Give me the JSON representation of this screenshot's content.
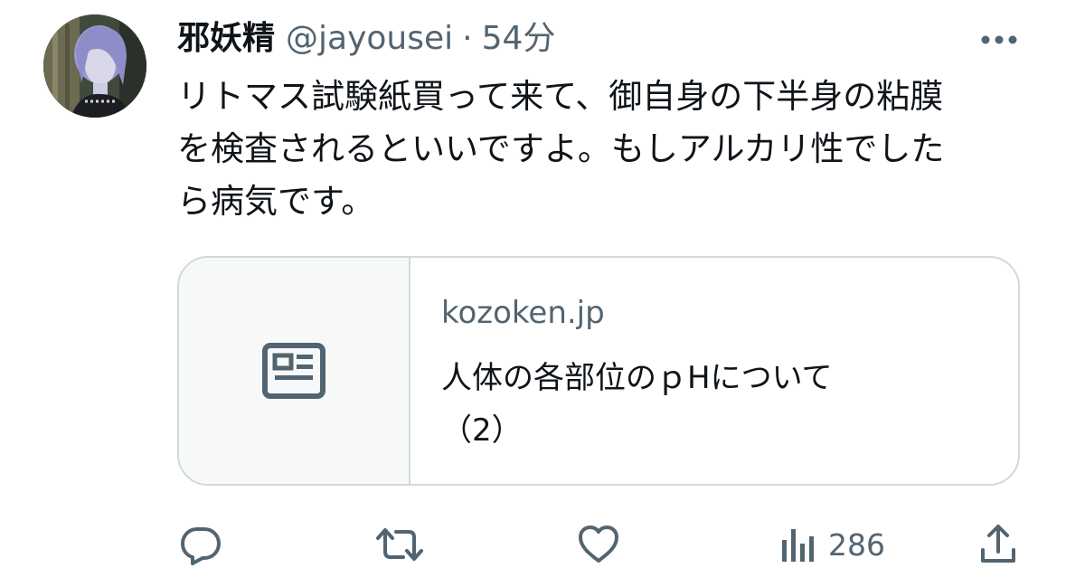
{
  "tweet": {
    "author": {
      "display_name": "邪妖精",
      "handle": "@jayousei",
      "separator": "·",
      "timestamp": "54分"
    },
    "text": "リトマス試験紙買って来て、御自身の下半身の粘膜\nを検査されるといいですよ。もしアルカリ性でした\nら病気です。",
    "card": {
      "domain": "kozoken.jp",
      "title": "人体の各部位のｐHについて\n（2）",
      "icon": "article-icon"
    },
    "actions": {
      "reply_icon": "reply-icon",
      "retweet_icon": "retweet-icon",
      "like_icon": "like-icon",
      "views_icon": "views-icon",
      "views_count": "286",
      "share_icon": "share-icon"
    },
    "colors": {
      "text": "#0f1419",
      "secondary": "#536471",
      "border": "#cfd9de",
      "card_media_bg": "#f7f9f9"
    }
  }
}
